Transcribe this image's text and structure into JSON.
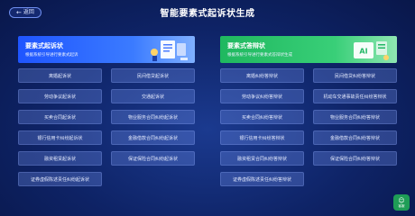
{
  "header": {
    "back_label": "返回",
    "title": "智能要素式起诉状生成"
  },
  "left_panel": {
    "title": "要素式起诉状",
    "subtitle": "根据系统引导进行要素式起诉",
    "accent": "#2a63ff",
    "items": [
      "离婚起诉状",
      "民间借贷起诉状",
      "劳动争议起诉状",
      "交通起诉状",
      "买卖合同起诉状",
      "物业服务合同纠纷起诉状",
      "银行信用卡纠纷起诉状",
      "金融借款合同纠纷起诉状",
      "融资租赁起诉状",
      "保证保险合同纠纷起诉状",
      "证券虚假陈述责任纠纷起诉状"
    ]
  },
  "right_panel": {
    "title": "要素式答辩状",
    "subtitle": "根据系统引导进行要素式答辩状生成",
    "accent": "#22c06a",
    "items": [
      "离婚纠纷答辩状",
      "民间借贷纠纷答辩状",
      "劳动争议纠纷答辩状",
      "机动车交通事故责任纠纷答辩状",
      "买卖合同纠纷答辩状",
      "物业服务合同纠纷答辩状",
      "银行信用卡纠纷答辩状",
      "金融借款合同纠纷答辩状",
      "融资租赁合同纠纷答辩状",
      "保证保险合同纠纷答辩状",
      "证券虚假陈述责任纠纷答辩状"
    ]
  },
  "corner_button": {
    "icon": "chat-icon",
    "label": "客服"
  }
}
